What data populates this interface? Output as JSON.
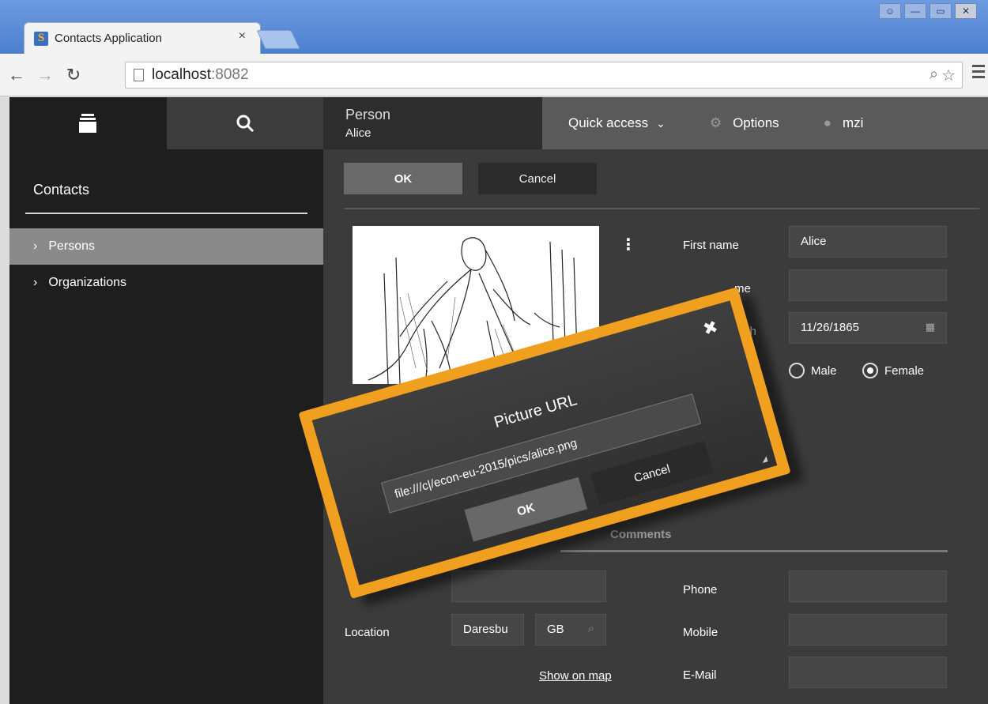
{
  "browser": {
    "tab_title": "Contacts Application",
    "tab_close": "×",
    "url_host": "localhost",
    "url_port": ":8082"
  },
  "sidebar": {
    "title": "Contacts",
    "items": [
      {
        "label": "Persons",
        "selected": true
      },
      {
        "label": "Organizations",
        "selected": false
      }
    ]
  },
  "header": {
    "type": "Person",
    "name": "Alice",
    "quick_access": "Quick access",
    "options": "Options",
    "user": "mzi"
  },
  "actions": {
    "ok": "OK",
    "cancel": "Cancel"
  },
  "form": {
    "first_name_label": "First name",
    "first_name_value": "Alice",
    "last_name_label_visible": "me",
    "last_name_value": "",
    "dob_label_visible": "irth",
    "dob_value": "11/26/1865",
    "gender_male": "Male",
    "gender_female": "Female",
    "gender_selected": "Female",
    "comments_tab": "Comments",
    "location_label": "Location",
    "city_value": "Daresbu",
    "country_value": "GB",
    "show_on_map": "Show on map",
    "phone_label": "Phone",
    "mobile_label": "Mobile",
    "email_label": "E-Mail"
  },
  "dialog": {
    "title": "Picture URL",
    "url_value": "file:///c|/econ-eu-2015/pics/alice.png",
    "ok": "OK",
    "cancel": "Cancel"
  },
  "colors": {
    "accent_frame": "#f0a01e",
    "sidebar_bg": "#1e1e1e",
    "main_bg": "#3b3b3b",
    "selected_item": "#8a8a8a"
  }
}
